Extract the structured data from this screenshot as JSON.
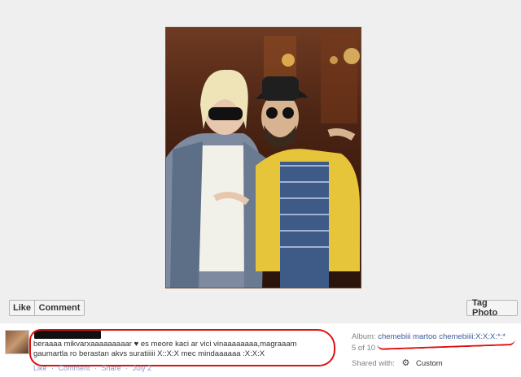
{
  "buttons": {
    "like": "Like",
    "comment": "Comment",
    "tag_photo": "Tag Photo"
  },
  "caption": {
    "text": "beraaaa mikvarxaaaaaaaaar ♥ es meore kaci ar vici vinaaaaaaaa,magraaam gaumartla ro berastan akvs suratiiiii X::X:X mec mindaaaaaa :X:X:X"
  },
  "actions": {
    "like": "Like",
    "sep1": "·",
    "comment": "Comment",
    "sep2": "·",
    "share": "Share",
    "sep3": "·",
    "date": "July 2"
  },
  "meta": {
    "album_label": "Album:",
    "album_name": "chemebiii martoo chemebiiii:X:X:X:*:*",
    "position": "5 of 10",
    "shared_label": "Shared with:",
    "shared_value": "Custom"
  },
  "icons": {
    "privacy": "gear-icon"
  }
}
